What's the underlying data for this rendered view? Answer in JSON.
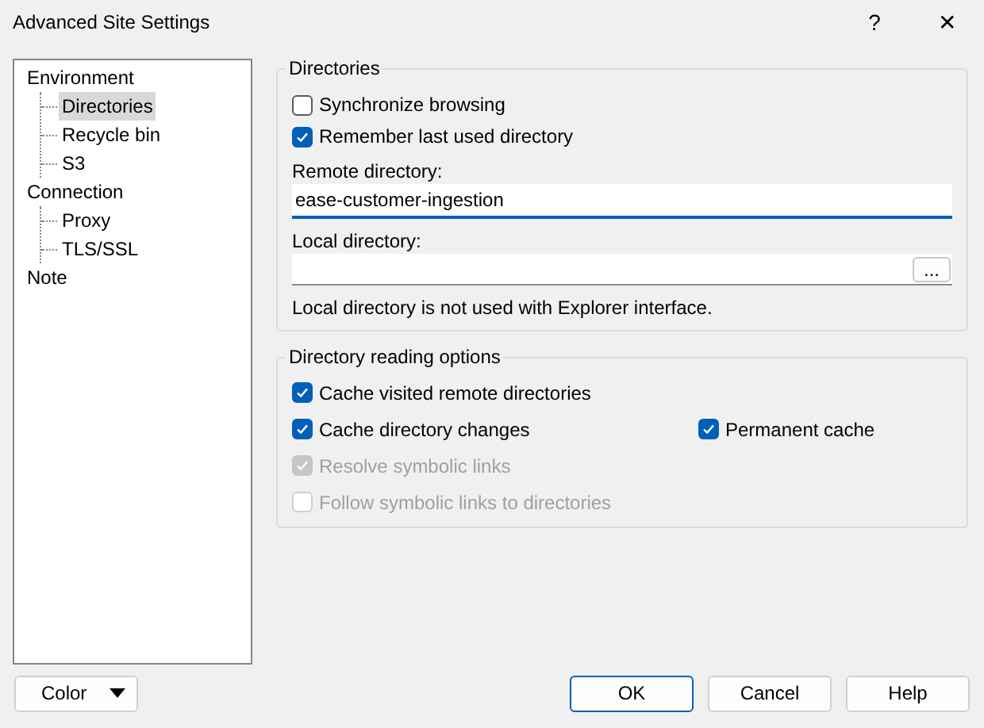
{
  "window": {
    "title": "Advanced Site Settings",
    "help_glyph": "?",
    "close_glyph": "✕"
  },
  "tree": [
    {
      "label": "Environment",
      "selected": false,
      "children": [
        {
          "label": "Directories",
          "selected": true
        },
        {
          "label": "Recycle bin",
          "selected": false
        },
        {
          "label": "S3",
          "selected": false
        }
      ]
    },
    {
      "label": "Connection",
      "selected": false,
      "children": [
        {
          "label": "Proxy",
          "selected": false
        },
        {
          "label": "TLS/SSL",
          "selected": false
        }
      ]
    },
    {
      "label": "Note",
      "selected": false
    }
  ],
  "directories": {
    "title": "Directories",
    "options": [
      {
        "label": "Synchronize browsing",
        "checked": false,
        "disabled": false
      },
      {
        "label": "Remember last used directory",
        "checked": true,
        "disabled": false
      }
    ],
    "remote_label": "Remote directory:",
    "remote_value": "ease-customer-ingestion",
    "local_label": "Local directory:",
    "browse_button": "...",
    "note": "Local directory is not used with Explorer interface."
  },
  "reading": {
    "title": "Directory reading options",
    "rows": [
      {
        "items": [
          {
            "label": "Cache visited remote directories",
            "checked": true,
            "disabled": false
          }
        ]
      },
      {
        "items": [
          {
            "label": "Cache directory changes",
            "checked": true,
            "disabled": false
          },
          {
            "label": "Permanent cache",
            "checked": true,
            "disabled": false
          }
        ]
      },
      {
        "items": [
          {
            "label": "Resolve symbolic links",
            "checked": true,
            "disabled": true
          }
        ]
      },
      {
        "items": [
          {
            "label": "Follow symbolic links to directories",
            "checked": false,
            "disabled": true
          }
        ]
      }
    ]
  },
  "color_button": "Color",
  "buttons": [
    {
      "label": "OK",
      "default": true
    },
    {
      "label": "Cancel",
      "default": false
    },
    {
      "label": "Help",
      "default": false
    }
  ]
}
